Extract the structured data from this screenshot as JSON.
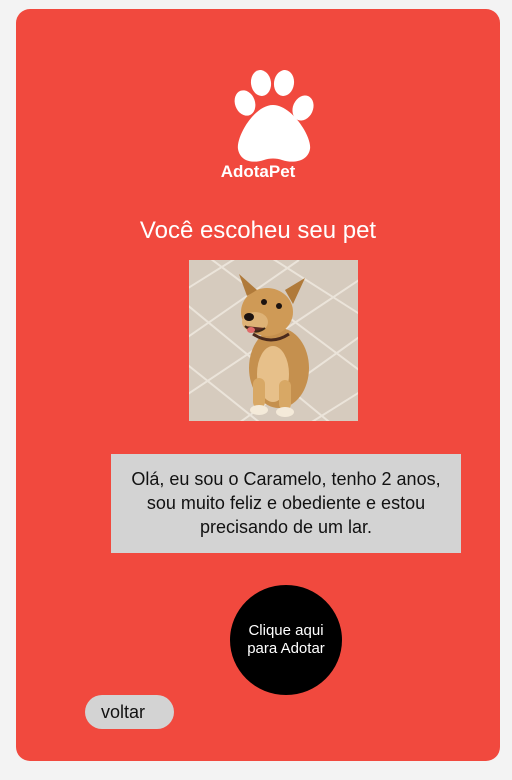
{
  "brand": {
    "name": "AdotaPet",
    "logo_icon": "paw-icon"
  },
  "headline": "Você escoheu seu pet",
  "pet": {
    "photo_icon": "dog-photo",
    "intro": "Olá, eu sou o Caramelo, tenho 2 anos, sou muito feliz e obediente e estou precisando de um lar."
  },
  "actions": {
    "adopt_label": "Clique aqui para Adotar",
    "back_label": "voltar"
  },
  "colors": {
    "background": "#f3f3f3",
    "card": "#f1493e",
    "adopt_button": "#000000",
    "neutral_box": "#d3d3d3"
  }
}
